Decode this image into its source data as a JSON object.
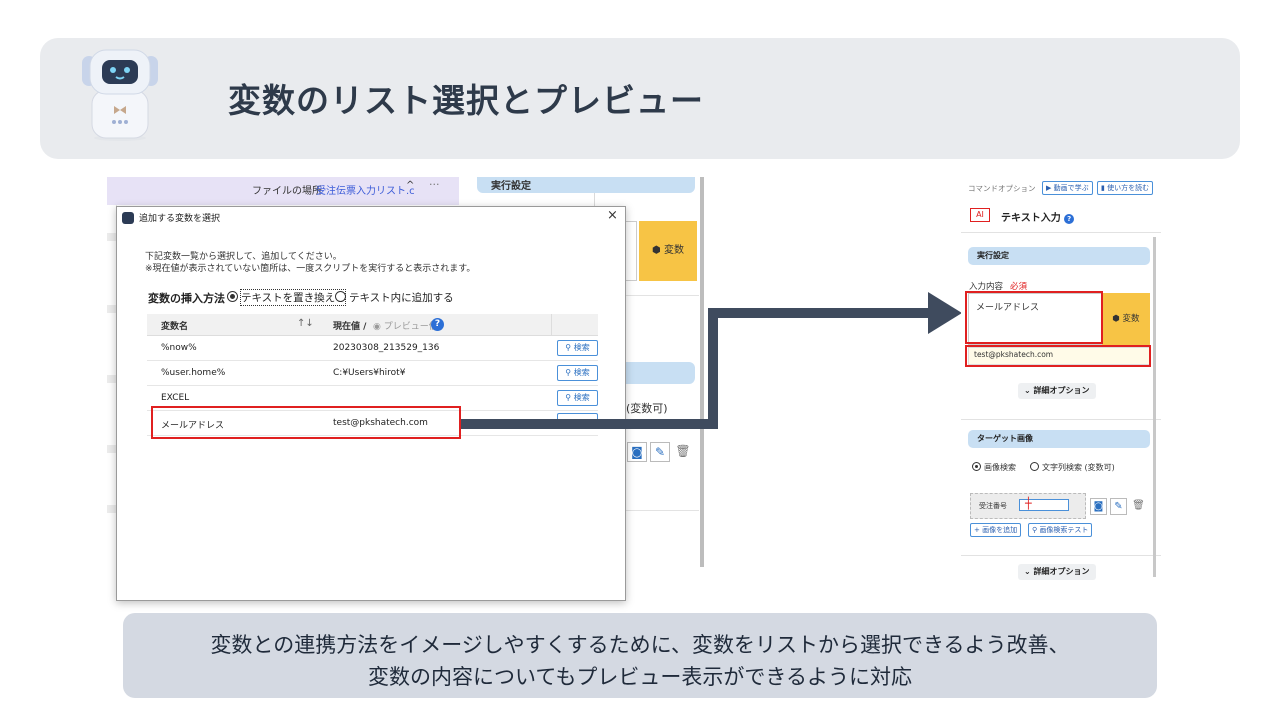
{
  "title": "変数のリスト選択とプレビュー",
  "left_panel": {
    "file_location_label": "ファイルの場所",
    "file_location_value": "受注伝票入力リスト.c",
    "caret": "^",
    "more": "···",
    "right_section_1": "実行設定",
    "variable_button": "変数",
    "variable_allowed": "(変数可)"
  },
  "dialog": {
    "title": "追加する変数を選択",
    "close": "×",
    "description_line1": "下記変数一覧から選択して、追加してください。",
    "description_line2": "※現在値が表示されていない箇所は、一度スクリプトを実行すると表示されます。",
    "insert_method_label": "変数の挿入方法",
    "option_replace": "テキストを置き換える",
    "option_append": "テキスト内に追加する",
    "col_name": "変数名",
    "col_sort": "↑↓",
    "col_current": "現在値 /",
    "col_preview": "プレビュー値",
    "help": "?",
    "rows": [
      {
        "name": "%now%",
        "value": "20230308_213529_136",
        "button": "検索"
      },
      {
        "name": "%user.home%",
        "value": "C:¥Users¥hirot¥",
        "button": "検索"
      },
      {
        "name": "EXCEL",
        "value": "",
        "button": "検索"
      },
      {
        "name": "メールアドレス",
        "value": "test@pkshatech.com",
        "button": ""
      }
    ]
  },
  "right_panel": {
    "command_option": "コマンドオプション",
    "chip_video": "動画で学ぶ",
    "chip_manual": "使い方を読む",
    "ai_badge": "AI",
    "command_title": "テキスト入力",
    "help": "?",
    "section_exec": "実行設定",
    "input_label": "入力内容",
    "required": "必須",
    "input_value": "メールアドレス",
    "variable_button": "変数",
    "preview_value": "test@pkshatech.com",
    "detail_option": "詳細オプション",
    "section_target": "ターゲット画像",
    "radio_image": "画像検索",
    "radio_text": "文字列検索 (変数可)",
    "image_label": "受注番号",
    "btn_add_image": "画像を追加",
    "btn_test": "画像検索テスト",
    "detail_option_2": "詳細オプション"
  },
  "caption": {
    "line1": "変数との連携方法をイメージしやすくするために、変数をリストから選択できるよう改善、",
    "line2": "変数の内容についてもプレビュー表示ができるように対応"
  },
  "colors": {
    "header_bg": "#e9ebee",
    "caption_bg": "#d4d9e2",
    "arrow": "#3f4b5e",
    "highlight": "#e02020",
    "variable_button": "#f7c445",
    "section_pill": "#c8dff3"
  }
}
